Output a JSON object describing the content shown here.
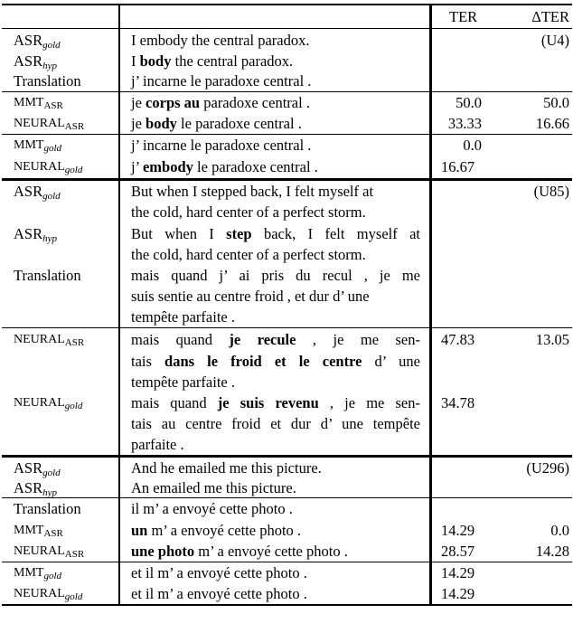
{
  "header": {
    "col_ter": "TER",
    "col_delta_ter": "ΔTER"
  },
  "blocks": [
    {
      "id": "U4",
      "tag": "(U4)",
      "source": [
        {
          "label": "ASR",
          "sub": "gold",
          "text": "I embody the central paradox."
        },
        {
          "label": "ASR",
          "sub": "hyp",
          "pre": "I ",
          "bold": "body",
          "post": " the central paradox."
        },
        {
          "label": "Translation",
          "text": "j’ incarne le paradoxe central ."
        }
      ],
      "asr_systems": [
        {
          "label": "MMT",
          "sub": "ASR",
          "pre": "je ",
          "bold": "corps au",
          "post": " paradoxe central .",
          "ter": "50.0",
          "delta_ter": "50.0"
        },
        {
          "label": "NEURAL",
          "sub": "ASR",
          "pre": "je ",
          "bold": "body",
          "post": " le paradoxe central .",
          "ter": "33.33",
          "delta_ter": "16.66"
        }
      ],
      "gold_systems": [
        {
          "label": "MMT",
          "sub": "gold",
          "text": "j’ incarne le paradoxe central .",
          "ter": "0.0"
        },
        {
          "label": "NEURAL",
          "sub": "gold",
          "pre": "j’ ",
          "bold": "embody",
          "post": " le paradoxe central .",
          "ter": "16.67"
        }
      ]
    },
    {
      "id": "U85",
      "tag": "(U85)",
      "source": [
        {
          "label": "ASR",
          "sub": "gold",
          "lines": [
            "But when I stepped back, I felt myself at",
            "the cold, hard center of a perfect storm."
          ]
        },
        {
          "label": "ASR",
          "sub": "hyp",
          "lines_pre": "But when I ",
          "bold": "step",
          "lines_post": " back, I felt myself at",
          "line2": "the cold, hard center of a perfect storm."
        },
        {
          "label": "Translation",
          "lines": [
            "mais quand j’ ai pris du recul , je me",
            "suis sentie au centre froid , et dur d’ une",
            "tempête parfaite ."
          ]
        }
      ],
      "systems": [
        {
          "label": "NEURAL",
          "sub": "ASR",
          "line1_pre": "mais quand ",
          "line1_bold": "je recule",
          "line1_post": " , je me sen-",
          "line2_pre": "tais ",
          "line2_bold": "dans le froid et le centre",
          "line2_post": " d’ une",
          "line3": "tempête parfaite .",
          "ter": "47.83",
          "delta_ter": "13.05"
        },
        {
          "label": "NEURAL",
          "sub": "gold",
          "line1_pre": "mais quand ",
          "line1_bold": "je suis revenu",
          "line1_post": " , je me sen-",
          "line2": "tais au centre froid et dur d’ une tempête",
          "line3": "parfaite .",
          "ter": "34.78"
        }
      ]
    },
    {
      "id": "U296",
      "tag": "(U296)",
      "source": [
        {
          "label": "ASR",
          "sub": "gold",
          "text": "And he emailed me this picture."
        },
        {
          "label": "ASR",
          "sub": "hyp",
          "text": "An emailed me this picture."
        }
      ],
      "middle": [
        {
          "label": "Translation",
          "text": "il m’ a envoyé cette photo ."
        },
        {
          "label": "MMT",
          "sub": "ASR",
          "bold": "un",
          "post": " m’ a envoyé cette photo .",
          "ter": "14.29",
          "delta_ter": "0.0"
        },
        {
          "label": "NEURAL",
          "sub": "ASR",
          "bold": "une photo",
          "post": " m’ a envoyé cette photo .",
          "ter": "28.57",
          "delta_ter": "14.28"
        }
      ],
      "gold_systems": [
        {
          "label": "MMT",
          "sub": "gold",
          "text": "et il m’ a envoyé cette photo .",
          "ter": "14.29"
        },
        {
          "label": "NEURAL",
          "sub": "gold",
          "text": "et il m’ a envoyé cette photo .",
          "ter": "14.29"
        }
      ]
    }
  ]
}
